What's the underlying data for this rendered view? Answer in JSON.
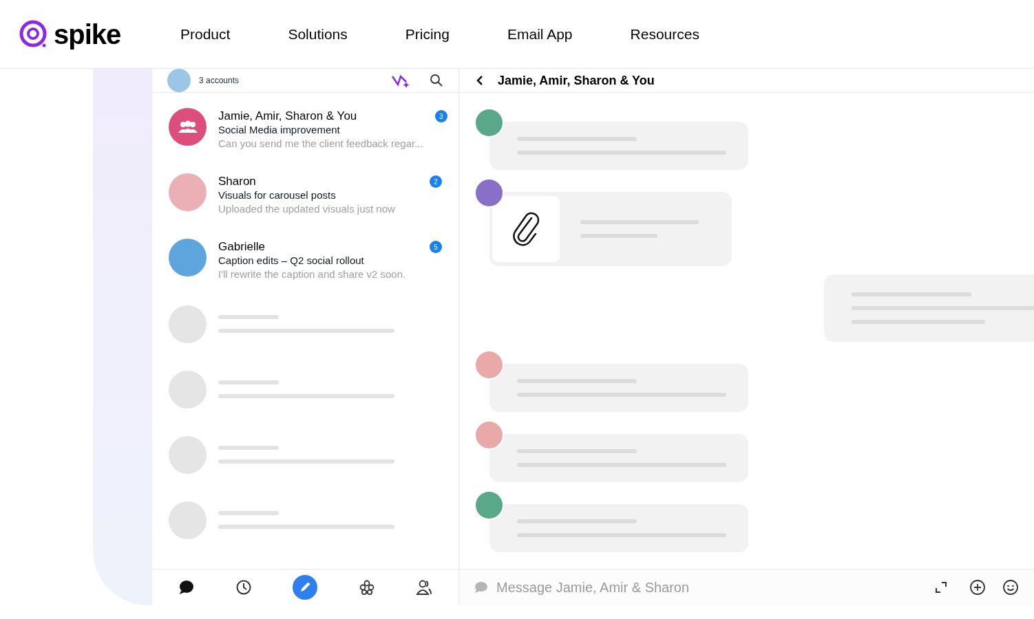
{
  "brand": {
    "name": "spike"
  },
  "nav": [
    "Product",
    "Solutions",
    "Pricing",
    "Email App",
    "Resources"
  ],
  "sidebar": {
    "accounts": "3 accounts",
    "conversations": [
      {
        "kind": "group",
        "name": "Jamie, Amir, Sharon & You",
        "subject": "Social Media improvement",
        "preview": "Can you send me the client feedback regar...",
        "unread": "3",
        "color": "#dc4f7d"
      },
      {
        "kind": "person",
        "name": "Sharon",
        "subject": "Visuals for carousel posts",
        "preview": "Uploaded the updated visuals just now",
        "unread": "2",
        "color": "#eab0b5"
      },
      {
        "kind": "person",
        "name": "Gabrielle",
        "subject": "Caption edits – Q2 social rollout",
        "preview": "I'll rewrite the caption and share v2 soon.",
        "unread": "5",
        "color": "#5fa5dd"
      },
      {
        "kind": "placeholder"
      },
      {
        "kind": "placeholder"
      },
      {
        "kind": "placeholder"
      },
      {
        "kind": "placeholder"
      }
    ],
    "tabs": [
      {
        "kind": "chats",
        "selected": true
      },
      {
        "kind": "history",
        "selected": false
      },
      {
        "kind": "compose",
        "selected": false
      },
      {
        "kind": "groups",
        "selected": false
      },
      {
        "kind": "contacts",
        "selected": false
      }
    ]
  },
  "chat": {
    "title": "Jamie, Amir, Sharon & You",
    "messages": [
      {
        "kind": "text",
        "color": "#5aa88a"
      },
      {
        "kind": "attachment",
        "color": "#8a6fc9"
      },
      {
        "kind": "outgoing"
      },
      {
        "kind": "text",
        "color": "#e9a9a9"
      },
      {
        "kind": "text",
        "color": "#e9a9a9"
      },
      {
        "kind": "text",
        "color": "#5aa88a"
      }
    ],
    "composer": {
      "placeholder": "Message Jamie, Amir & Sharon"
    }
  }
}
